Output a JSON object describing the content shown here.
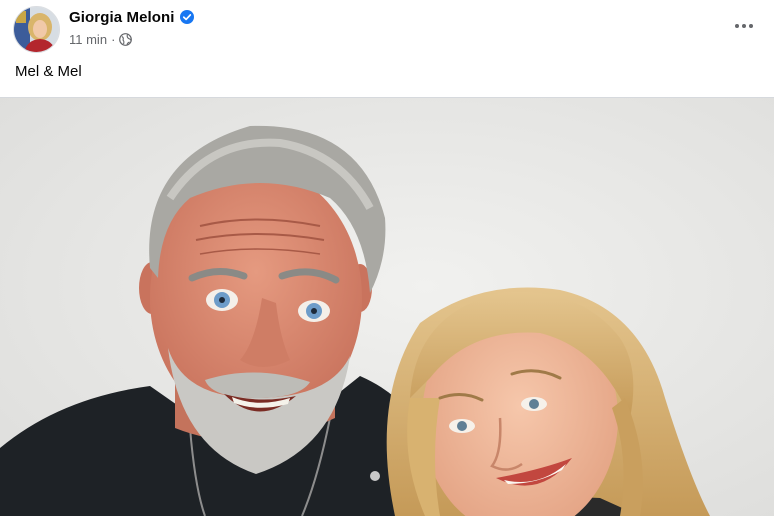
{
  "post": {
    "author": "Giorgia Meloni",
    "verified": true,
    "timestamp": "11 min",
    "separator": "·",
    "audience_icon": "globe-icon",
    "caption": "Mel & Mel",
    "more_icon": "more-options-icon",
    "photo_alt": "Mel & Mel"
  },
  "colors": {
    "verified_badge": "#1877f2",
    "meta_text": "#65676b",
    "photo_background": "#ebebe9"
  }
}
